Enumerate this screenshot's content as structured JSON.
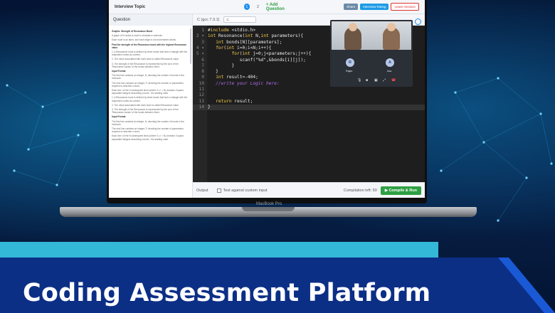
{
  "app": {
    "topic": "Interview Topic",
    "question_tabs": [
      "1",
      "2"
    ],
    "add_question": "+ Add Question",
    "buttons": {
      "share": "Share",
      "rating": "Interview Rating",
      "leave": "Leave Session"
    }
  },
  "question_panel": {
    "header": "Question",
    "title": "Graphs: Strength of Resonance Bond",
    "paragraphs": [
      "A graph of N nodes is used to simulate a molecule.",
      "Each node is an atom, and each edge is a bond between atoms.",
      "Find the strength of the Resonance bond with the highest Resonance value.",
      "1. A Resonance bond is defined by three bonds that form a triangle with the respective nodes as corners.",
      "2. The value associated with each bond is called Resonance value.",
      "3. The strength of the Resonance is represented by the sum of the 'Resonance values' of the bonds between them.",
      "Input Format",
      "The first line contains an integer, N, denoting the number of bonds in the molecule.",
      "The next line contains an integer, P, denoting the number of parameters required to describe a bond.",
      "Each line i of the N subsequent lines (where 0 ≤ i < N) contains 3 space-separated integers describing a bond - the starting node",
      "1. A Resonance bond is defined by three bonds that form a triangle with the respective nodes as corners.",
      "2. The value associated with each bond is called Resonance value.",
      "3. The strength of the Resonance is represented by the sum of the 'Resonance values' of the bonds between them.",
      "Input Format",
      "The first line contains an integer, N, denoting the number of bonds in the molecule.",
      "The next line contains an integer, P, denoting the number of parameters required to describe a bond.",
      "Each line i of the N subsequent lines (where 0 ≤ i < N) contains 3 space-separated integers describing a bond - the starting node"
    ]
  },
  "editor": {
    "language_label": "C (gcc 7.3.1)",
    "language_select": "C",
    "lines": [
      {
        "n": "1",
        "text": "#include <stdio.h>"
      },
      {
        "n": "2 ▾",
        "text": "int Resonance(int N,int parameters){"
      },
      {
        "n": "3",
        "text": "   int bonds[N][parameters];"
      },
      {
        "n": "4 ▾",
        "text": "   for(int i=0;i<N;i++){"
      },
      {
        "n": "5 ▾",
        "text": "         for(int j=0;j<parameters;j++){"
      },
      {
        "n": "6",
        "text": "            scanf(\"%d\",&bonds[i][j]);"
      },
      {
        "n": "7",
        "text": "         }"
      },
      {
        "n": "8",
        "text": "   }"
      },
      {
        "n": "9",
        "text": "   int result=-404;"
      },
      {
        "n": "10",
        "text": "   //write your Logic here:"
      },
      {
        "n": "11",
        "text": ""
      },
      {
        "n": "12",
        "text": ""
      },
      {
        "n": "13",
        "text": "   return result;"
      },
      {
        "n": "14",
        "text": "}"
      }
    ]
  },
  "video": {
    "participants": [
      {
        "initial": "R",
        "name": "Rajan"
      },
      {
        "initial": "A",
        "name": "Asa"
      }
    ]
  },
  "bottom": {
    "output": "Output",
    "custom_input": "Test against custom input",
    "compilation_left": "Compilation left: 50",
    "run": "▶ Compile & Run"
  },
  "device_label": "MacBook Pro",
  "banner": {
    "title": "Coding Assessment Platform"
  },
  "colors": {
    "background": "#061a3a",
    "band_light": "#33b8d8",
    "band_dark": "#0c2f86",
    "run_green": "#2ea043",
    "accent_blue": "#1e8ef0",
    "keyword_yellow": "#fbd04c",
    "comment_purple": "#b06ce8"
  }
}
